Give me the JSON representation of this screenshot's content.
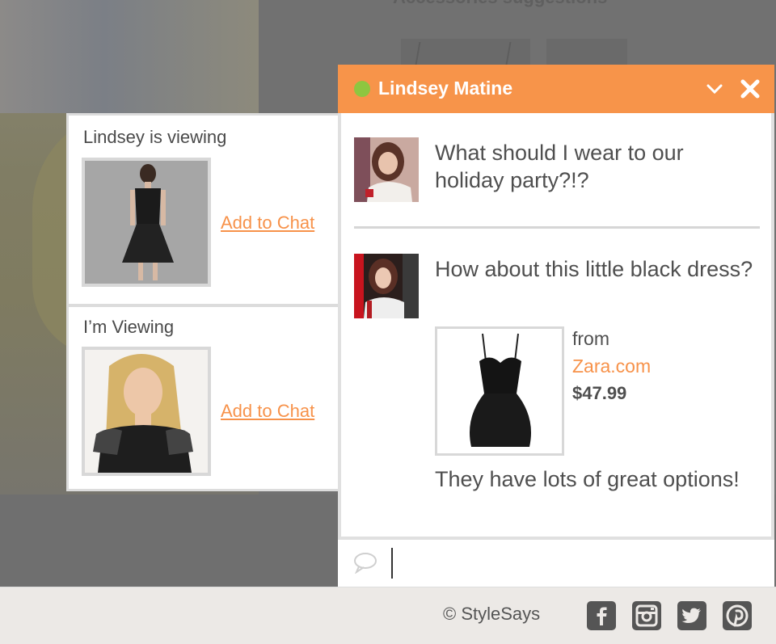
{
  "background": {
    "heading": "Accessories suggestions"
  },
  "chat": {
    "contact_name": "Lindsey Matine",
    "status_color": "#8ec640",
    "accent_color": "#f7944a",
    "messages": [
      {
        "text": "What should I wear to our holiday party?!?"
      },
      {
        "text": "How about this little black dress?"
      },
      {
        "text": "They have lots of great options!"
      }
    ],
    "product": {
      "from_label": "from",
      "store": "Zara.com",
      "price": "$47.99"
    },
    "input_value": ""
  },
  "viewing": {
    "lindsey_title": "Lindsey is viewing",
    "me_title": "I’m Viewing",
    "add_to_chat_label": "Add to Chat"
  },
  "footer": {
    "copyright": "© StyleSays",
    "social": [
      "facebook-icon",
      "instagram-icon",
      "twitter-icon",
      "pinterest-icon"
    ]
  }
}
